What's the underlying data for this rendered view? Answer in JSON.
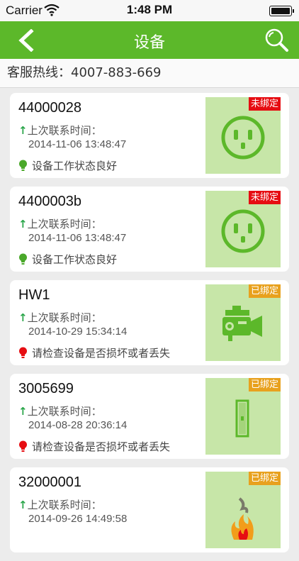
{
  "status_bar": {
    "carrier": "Carrier",
    "time": "1:48 PM"
  },
  "nav": {
    "title": "设备"
  },
  "hotline": {
    "text": "客服热线：4007-883-669"
  },
  "devices": [
    {
      "name": "44000028",
      "last_label": "上次联系时间：",
      "last_time": "2014-11-06 13:48:47",
      "status": "设备工作状态良好",
      "status_ok": true,
      "badge": "未绑定",
      "badge_type": "unbound",
      "icon": "socket-icon"
    },
    {
      "name": "4400003b",
      "last_label": "上次联系时间：",
      "last_time": "2014-11-06 13:48:47",
      "status": "设备工作状态良好",
      "status_ok": true,
      "badge": "未绑定",
      "badge_type": "unbound",
      "icon": "socket-icon"
    },
    {
      "name": "HW1",
      "last_label": "上次联系时间：",
      "last_time": "2014-10-29 15:34:14",
      "status": "请检查设备是否损坏或者丢失",
      "status_ok": false,
      "badge": "已绑定",
      "badge_type": "bound",
      "icon": "camera-icon"
    },
    {
      "name": "3005699",
      "last_label": "上次联系时间：",
      "last_time": "2014-08-28 20:36:14",
      "status": "请检查设备是否损坏或者丢失",
      "status_ok": false,
      "badge": "已绑定",
      "badge_type": "bound",
      "icon": "door-sensor-icon"
    },
    {
      "name": "32000001",
      "last_label": "上次联系时间：",
      "last_time": "2014-09-26 14:49:58",
      "status": "",
      "status_ok": false,
      "badge": "已绑定",
      "badge_type": "bound",
      "icon": "fire-smoke-icon"
    }
  ],
  "colors": {
    "brand_green": "#5cb82a",
    "unbound_badge": "#e60d12",
    "bound_badge": "#e8a11e",
    "thumb_bg": "#c7e6a8"
  }
}
